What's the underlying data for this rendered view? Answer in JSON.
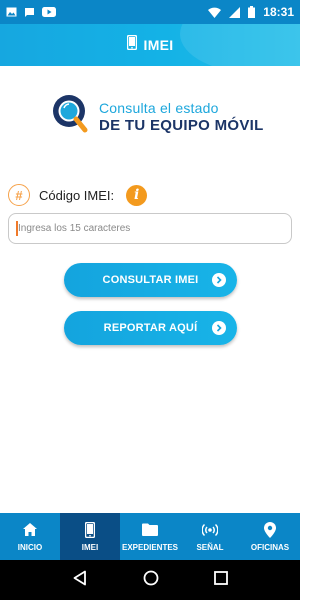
{
  "status_bar": {
    "time": "18:31",
    "icons": [
      "image-icon",
      "chat-icon",
      "youtube-icon",
      "wifi-icon",
      "signal-icon",
      "battery-icon"
    ]
  },
  "header": {
    "title": "IMEI",
    "icon": "phone-icon"
  },
  "logo": {
    "line1": "Consulta el estado",
    "line2": "DE TU EQUIPO MÓVIL",
    "colors": {
      "light": "#1da7dc",
      "dark": "#1c3567"
    }
  },
  "form": {
    "badge": "#",
    "label": "Código IMEI:",
    "info_icon": "i",
    "input_placeholder": "Ingresa los 15 caracteres",
    "input_value": ""
  },
  "buttons": {
    "consultar": "CONSULTAR IMEI",
    "reportar": "REPORTAR AQUÍ"
  },
  "bottom_nav": {
    "active": "IMEI",
    "items": [
      {
        "label": "INICIO",
        "icon": "home-icon"
      },
      {
        "label": "IMEI",
        "icon": "phone-icon"
      },
      {
        "label": "EXPEDIENTES",
        "icon": "folder-icon"
      },
      {
        "label": "SEÑAL",
        "icon": "signal-waves-icon"
      },
      {
        "label": "OFICINAS",
        "icon": "location-pin-icon"
      }
    ]
  },
  "colors": {
    "primary": "#0b86c7",
    "header": "#16a7e0",
    "button": "#18b4e8",
    "nav_active": "#0a4e86",
    "accent_orange": "#f39a1e"
  }
}
